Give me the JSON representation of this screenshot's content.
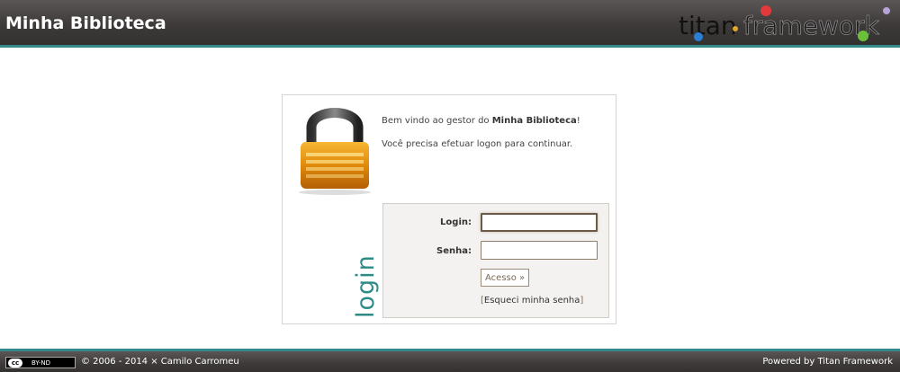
{
  "header": {
    "app_title": "Minha Biblioteca",
    "brand_logo": {
      "text_part1": "titan",
      "text_part2": "framework",
      "icon": "titan-framework-logo"
    }
  },
  "login": {
    "welcome_prefix": "Bem vindo ao gestor do ",
    "welcome_app": "Minha Biblioteca",
    "welcome_suffix": "!",
    "instruction": "Você precisa efetuar logon para continuar.",
    "side_title": "login",
    "lock_icon": "padlock-icon",
    "fields": {
      "login_label": "Login:",
      "login_value": "",
      "password_label": "Senha:",
      "password_value": ""
    },
    "submit_label": "Acesso »",
    "forgot_open": "[",
    "forgot_label": "Esqueci minha senha",
    "forgot_close": "]"
  },
  "footer": {
    "license_badge_cc": "cc",
    "license_badge_text": "BY-ND",
    "copyright": "© 2006 - 2014 × Camilo Carromeu",
    "powered_by": "Powered by Titan Framework"
  },
  "colors": {
    "header_bg": "#3d3a39",
    "accent_teal": "#35898a",
    "login_text": "#2e8b87",
    "panel_bg": "#f3f2f0"
  }
}
